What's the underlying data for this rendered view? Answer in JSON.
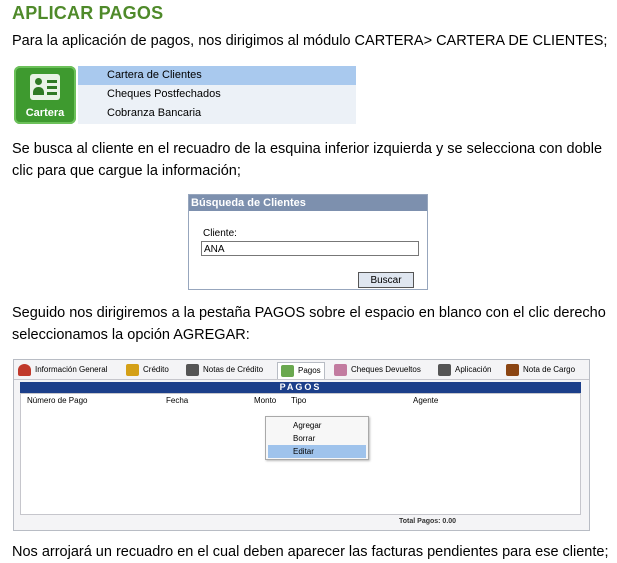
{
  "heading": "APLICAR PAGOS",
  "paragraphs": [
    "Para la aplicación de pagos, nos dirigimos al módulo CARTERA> CARTERA DE CLIENTES;",
    "Se busca al cliente en el recuadro de la esquina inferior izquierda y se selecciona con doble",
    "clic para que cargue la información;",
    "Seguido nos dirigiremos a la pestaña PAGOS sobre el espacio en blanco con el clic derecho",
    "seleccionamos la opción AGREGAR:",
    "Nos arrojará un recuadro en el cual deben aparecer las facturas pendientes para ese cliente;"
  ],
  "module": {
    "label": "Cartera",
    "icon": "id-card-icon",
    "color": "#3e9a2f",
    "menu_items": [
      "Cartera de Clientes",
      "Cheques Postfechados",
      "Cobranza Bancaria"
    ],
    "selected_index": 0
  },
  "search": {
    "title": "Búsqueda de Clientes",
    "field_label": "Cliente:",
    "field_value": "ANA",
    "button": "Buscar"
  },
  "tabs": [
    {
      "label": "Información General",
      "icon": "person-icon",
      "color": "#c0392b"
    },
    {
      "label": "Crédito",
      "icon": "calendar-icon",
      "color": "#d4a017"
    },
    {
      "label": "Notas de Crédito",
      "icon": "pen-icon",
      "color": "#555555"
    },
    {
      "label": "Pagos",
      "icon": "money-icon",
      "color": "#6aa84f"
    },
    {
      "label": "Cheques Devueltos",
      "icon": "cheque-icon",
      "color": "#c27ba0"
    },
    {
      "label": "Aplicación",
      "icon": "pen-icon",
      "color": "#555555"
    },
    {
      "label": "Nota de Cargo",
      "icon": "pen-icon",
      "color": "#8b4513"
    }
  ],
  "active_tab": 3,
  "pagos": {
    "bar_title": "PAGOS",
    "columns": [
      "Número de Pago",
      "Fecha",
      "Monto",
      "Tipo",
      "Agente"
    ],
    "context_menu": [
      "Agregar",
      "Borrar",
      "Editar"
    ],
    "highlighted_option": 2,
    "total": "Total Pagos: 0.00"
  }
}
